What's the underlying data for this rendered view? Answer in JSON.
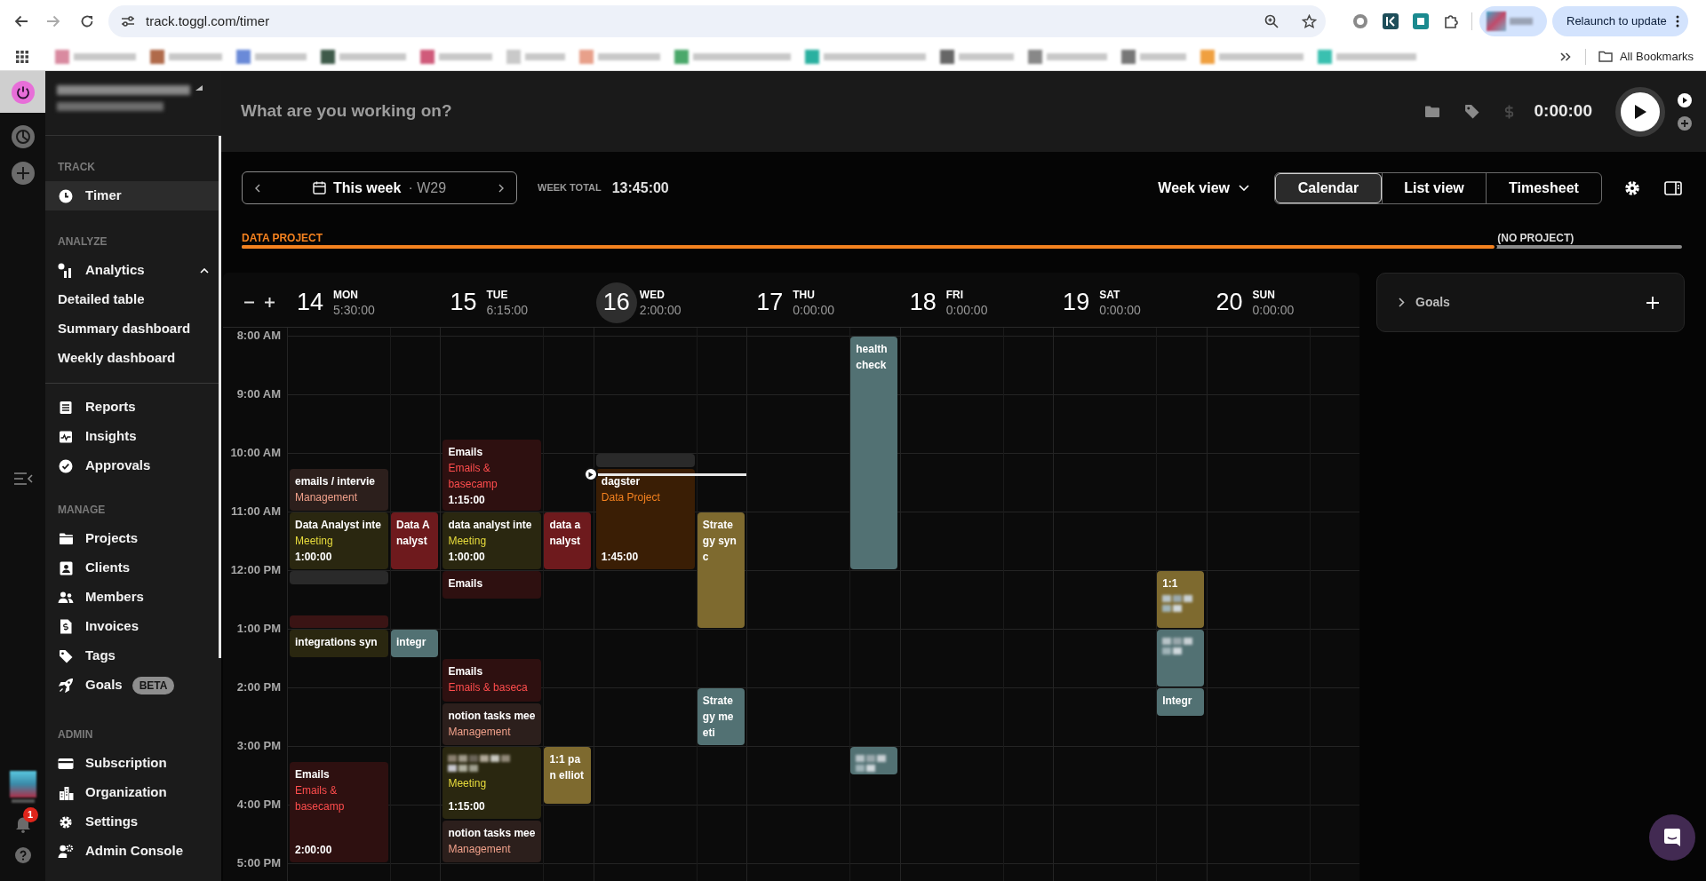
{
  "browser": {
    "url": "track.toggl.com/timer",
    "relaunch_button": "Relaunch to update",
    "all_bookmarks": "All Bookmarks"
  },
  "rail": {
    "notifications_badge": "1"
  },
  "sidebar": {
    "sections": [
      {
        "heading": "TRACK",
        "items": [
          {
            "label": "Timer",
            "selected": true
          }
        ]
      },
      {
        "heading": "ANALYZE",
        "items": [
          {
            "label": "Analytics",
            "selected": false,
            "expanded": true,
            "children": [
              {
                "label": "Detailed table",
                "selected": false
              },
              {
                "label": "Summary dashboard",
                "selected": false
              },
              {
                "label": "Weekly dashboard",
                "selected": false
              }
            ]
          }
        ]
      },
      {
        "items": [
          {
            "label": "Reports",
            "selected": false
          },
          {
            "label": "Insights",
            "selected": false
          },
          {
            "label": "Approvals",
            "selected": false
          }
        ]
      },
      {
        "heading": "MANAGE",
        "items": [
          {
            "label": "Projects",
            "selected": false
          },
          {
            "label": "Clients",
            "selected": false
          },
          {
            "label": "Members",
            "selected": false
          },
          {
            "label": "Invoices",
            "selected": false
          },
          {
            "label": "Tags",
            "selected": false
          },
          {
            "label": "Goals",
            "selected": false,
            "badge": "BETA"
          }
        ]
      }
    ],
    "admin": {
      "heading": "ADMIN",
      "items": [
        {
          "label": "Subscription",
          "selected": false
        },
        {
          "label": "Organization",
          "selected": false
        },
        {
          "label": "Settings",
          "selected": false
        },
        {
          "label": "Admin Console",
          "selected": false
        }
      ]
    }
  },
  "timer_bar": {
    "placeholder": "What are you working on?",
    "billable": false,
    "elapsed": "0:00:00"
  },
  "toolbar": {
    "week_label": "This week",
    "week_number": "· W29",
    "week_total_label": "WEEK TOTAL",
    "week_total": "13:45:00",
    "view_select": "Week view",
    "view_tabs": [
      {
        "label": "Calendar",
        "selected": true
      },
      {
        "label": "List view",
        "selected": false
      },
      {
        "label": "Timesheet",
        "selected": false
      }
    ]
  },
  "project_breakdown": {
    "level": 0.87,
    "projects": [
      {
        "name": "DATA PROJECT",
        "color": "#f5821f"
      },
      {
        "name": "(NO PROJECT)",
        "color": "#8a8a8a"
      }
    ]
  },
  "calendar": {
    "hours": [
      "8:00 AM",
      "9:00 AM",
      "10:00 AM",
      "11:00 AM",
      "12:00 PM",
      "1:00 PM",
      "2:00 PM",
      "3:00 PM",
      "4:00 PM",
      "5:00 PM"
    ],
    "days": [
      {
        "number": "14",
        "weekday": "MON",
        "total": "5:30:00",
        "today": false,
        "events": [
          {
            "kind": "entry",
            "color": "#2c1f1c",
            "title": "emails / intervie",
            "project": {
              "name": "Management",
              "color": "#f0a08a"
            }
          },
          {
            "kind": "entry",
            "color": "#2a2710",
            "title": "Data Analyst inte",
            "project": {
              "name": "Meeting",
              "color": "#e8dc3c"
            },
            "duration": "1:00:00"
          },
          {
            "kind": "entry",
            "color": "#2a2a2a"
          },
          {
            "kind": "entry",
            "color": "#3a1414"
          },
          {
            "kind": "entry",
            "color": "#2a2710",
            "title": "integrations syn"
          },
          {
            "kind": "entry",
            "color": "#2e1010",
            "title": "Emails",
            "project": {
              "name": "Emails & basecamp",
              "color": "#ff4d4d"
            },
            "duration": "2:00:00"
          },
          {
            "kind": "calendar",
            "color": "#6e1a1d",
            "title": "Data Analyst"
          },
          {
            "kind": "calendar",
            "color": "#527173",
            "title": "integr"
          }
        ]
      },
      {
        "number": "15",
        "weekday": "TUE",
        "total": "6:15:00",
        "today": false,
        "events": [
          {
            "kind": "entry",
            "color": "#2e1010",
            "title": "Emails",
            "project": {
              "name": "Emails & basecamp",
              "color": "#ff4d4d"
            },
            "duration": "1:15:00"
          },
          {
            "kind": "entry",
            "color": "#2a2710",
            "title": "data analyst inte",
            "project": {
              "name": "Meeting",
              "color": "#e8dc3c"
            },
            "duration": "1:00:00"
          },
          {
            "kind": "entry",
            "color": "#2e1010",
            "title": "Emails"
          },
          {
            "kind": "entry",
            "color": "#2e1010",
            "title": "Emails",
            "project": {
              "name": "Emails & baseca",
              "color": "#ff4d4d"
            }
          },
          {
            "kind": "entry",
            "color": "#2c1f1c",
            "title": "notion tasks mee",
            "project": {
              "name": "Management",
              "color": "#f0a08a"
            }
          },
          {
            "kind": "entry",
            "color": "#2a2710",
            "title_blurred": true,
            "project": {
              "name": "Meeting",
              "color": "#e8dc3c"
            },
            "duration": "1:15:00"
          },
          {
            "kind": "entry",
            "color": "#2c1f1c",
            "title": "notion tasks mee",
            "project": {
              "name": "Management",
              "color": "#f0a08a"
            }
          },
          {
            "kind": "calendar",
            "color": "#6e1a1d",
            "title": "data analyst"
          },
          {
            "kind": "calendar",
            "color": "#7e6a2f",
            "title": "1:1 pan elliot"
          }
        ]
      },
      {
        "number": "16",
        "weekday": "WED",
        "total": "2:00:00",
        "today": true,
        "events": [
          {
            "kind": "entry",
            "color": "#2a2a2a"
          },
          {
            "kind": "entry",
            "color": "#3a1e05",
            "title": "dagster",
            "project": {
              "name": "Data Project",
              "color": "#f5821f"
            },
            "duration": "1:45:00"
          },
          {
            "kind": "calendar",
            "color": "#7e6a2f",
            "title": "Strategy sync"
          },
          {
            "kind": "calendar",
            "color": "#527173",
            "title": "Strategy meeti"
          }
        ]
      },
      {
        "number": "17",
        "weekday": "THU",
        "total": "0:00:00",
        "today": false,
        "events": [
          {
            "kind": "calendar",
            "color": "#527173",
            "title": "health check"
          },
          {
            "kind": "calendar",
            "color": "#527173",
            "title_blurred": true
          }
        ]
      },
      {
        "number": "18",
        "weekday": "FRI",
        "total": "0:00:00",
        "today": false
      },
      {
        "number": "19",
        "weekday": "SAT",
        "total": "0:00:00",
        "today": false,
        "events": [
          {
            "kind": "calendar",
            "color": "#7e6a2f",
            "title": "1:1",
            "title_blurred": true
          },
          {
            "kind": "calendar",
            "color": "#527173",
            "title_blurred": true
          },
          {
            "kind": "calendar",
            "color": "#527173",
            "title": "Integr"
          }
        ]
      },
      {
        "number": "20",
        "weekday": "SUN",
        "total": "0:00:00",
        "today": false
      }
    ]
  },
  "goals": {
    "title": "Goals",
    "expanded": false
  }
}
